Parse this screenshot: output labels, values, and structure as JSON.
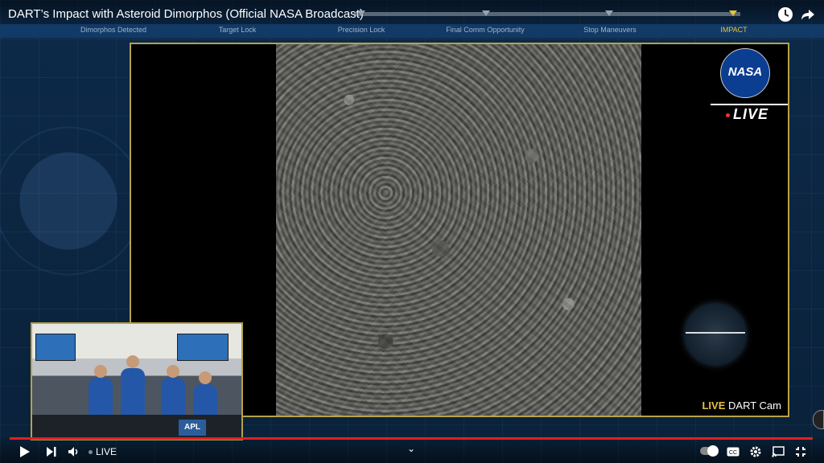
{
  "player": {
    "title": "DART’s Impact with Asteroid Dimorphos (Official NASA Broadcast)",
    "icons": {
      "watch_later": "clock-icon",
      "share": "share-arrow-icon"
    }
  },
  "timeline": {
    "stages": [
      {
        "label": "Dimorphos Detected",
        "active": false
      },
      {
        "label": "Target Lock",
        "active": false
      },
      {
        "label": "Precision Lock",
        "active": false
      },
      {
        "label": "Final Comm Opportunity",
        "active": false
      },
      {
        "label": "Stop Maneuvers",
        "active": false
      },
      {
        "label": "IMPACT",
        "active": true
      }
    ],
    "accent_color": "#e6c23a"
  },
  "feed": {
    "nasa_logo_text": "NASA",
    "live_badge": "LIVE",
    "cam_label_live": "LIVE",
    "cam_label_name": "DART Cam",
    "frame_color": "#b7a24a"
  },
  "inset": {
    "apl_label": "APL"
  },
  "controls": {
    "live_label": "LIVE",
    "progress_color": "#e02020",
    "icons": [
      "play-icon",
      "next-icon",
      "volume-icon",
      "chevron-down-icon",
      "autoplay-toggle",
      "cc-icon",
      "settings-icon",
      "cast-icon",
      "exit-fullscreen-icon"
    ]
  }
}
